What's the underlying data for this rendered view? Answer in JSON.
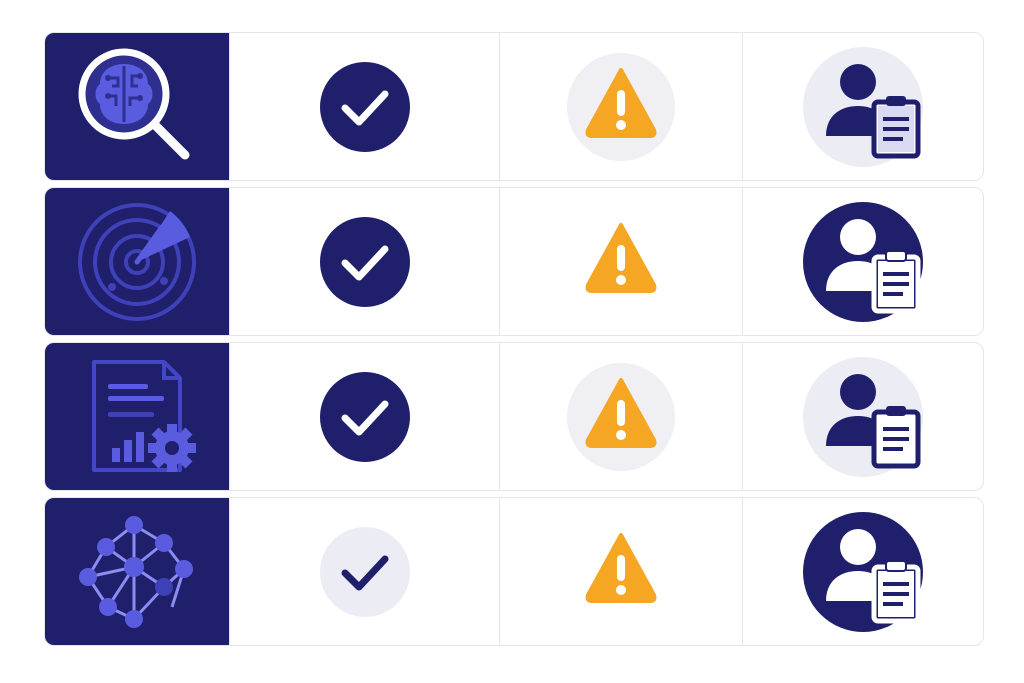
{
  "colors": {
    "navy": "#1f1f6b",
    "accent": "#4a4cd6",
    "warning": "#f5a623",
    "soft_bg": "#ececf4",
    "line": "#e6e6ea"
  },
  "rows": [
    {
      "category_icon": "brain-magnifier-icon",
      "status_icon": "check-circle-icon",
      "status_style": "filled",
      "warning_icon": "warning-triangle-icon",
      "warning_style": "soft-background",
      "owner_icon": "person-clipboard-icon",
      "owner_style": "soft-background"
    },
    {
      "category_icon": "radar-icon",
      "status_icon": "check-circle-icon",
      "status_style": "filled",
      "warning_icon": "warning-triangle-icon",
      "warning_style": "plain",
      "owner_icon": "person-clipboard-icon",
      "owner_style": "filled"
    },
    {
      "category_icon": "report-gear-icon",
      "status_icon": "check-circle-icon",
      "status_style": "filled",
      "warning_icon": "warning-triangle-icon",
      "warning_style": "soft-background",
      "owner_icon": "person-clipboard-icon",
      "owner_style": "soft-background"
    },
    {
      "category_icon": "network-graph-icon",
      "status_icon": "check-circle-icon",
      "status_style": "soft",
      "warning_icon": "warning-triangle-icon",
      "warning_style": "plain",
      "owner_icon": "person-clipboard-icon",
      "owner_style": "filled"
    }
  ]
}
